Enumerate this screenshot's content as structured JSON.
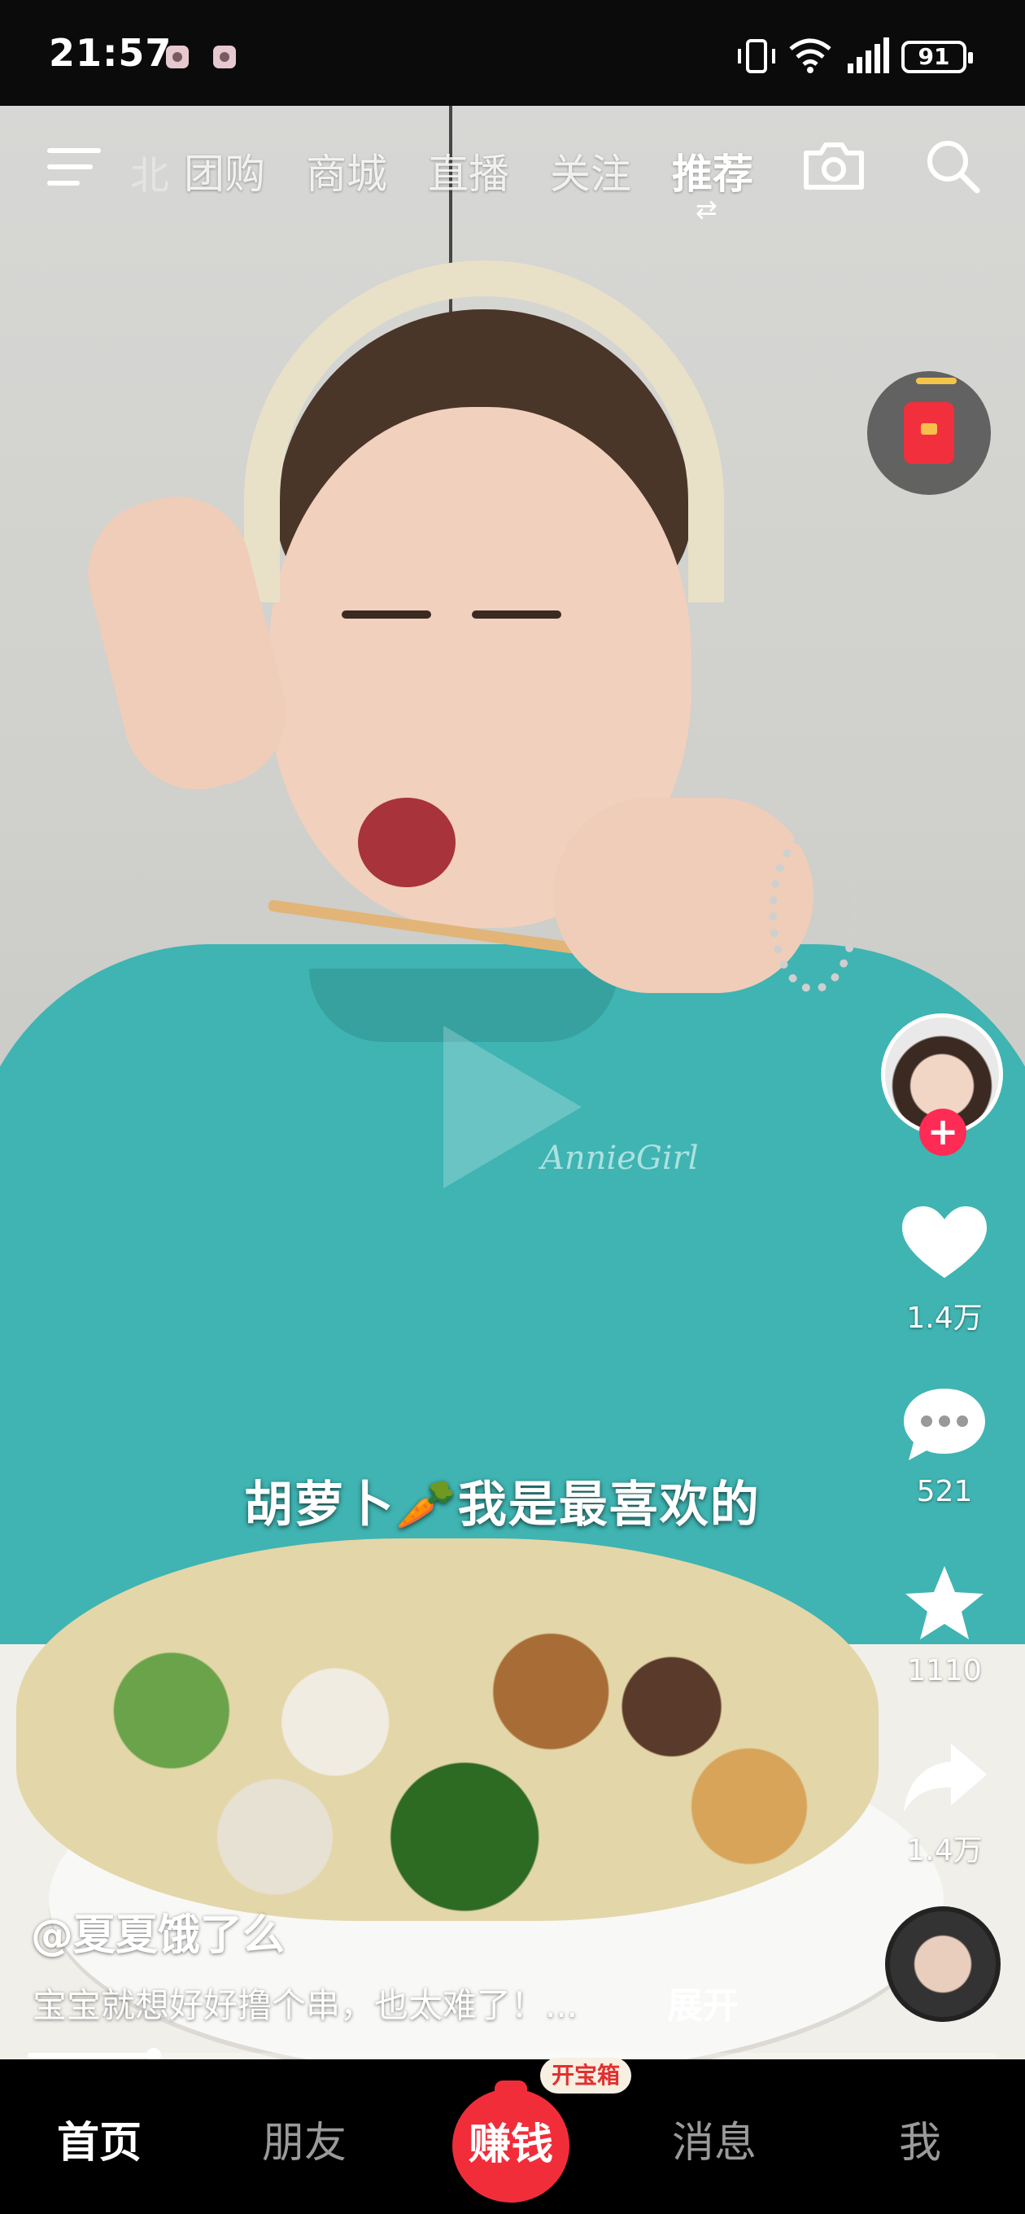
{
  "status_bar": {
    "time": "21:57",
    "battery": "91"
  },
  "top_nav": {
    "ghost_tab": "北",
    "tabs": [
      "团购",
      "商城",
      "直播",
      "关注",
      "推荐"
    ],
    "active_tab": "推荐",
    "swap_glyph": "⇄"
  },
  "video": {
    "subtitle": "胡萝卜🥕我是最喜欢的",
    "shirt_brand": "AnnieGirl"
  },
  "rail": {
    "likes": "1.4万",
    "comments": "521",
    "favorites": "1110",
    "shares": "1.4万",
    "follow_glyph": "+"
  },
  "caption": {
    "username": "@夏夏饿了么",
    "description": "宝宝就想好好撸个串，也太难了！...",
    "expand_label": "展开"
  },
  "progress": {
    "played_fraction": 0.13
  },
  "bottom_nav": {
    "items": [
      "首页",
      "朋友",
      "赚钱",
      "消息",
      "我"
    ],
    "active": "首页",
    "chest_badge": "开宝箱"
  },
  "colors": {
    "accent_red": "#fe2c55",
    "earn_red": "#f22d3a",
    "shirt": "#3fb4b2"
  }
}
